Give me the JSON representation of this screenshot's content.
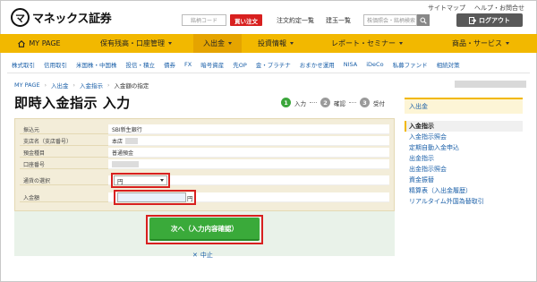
{
  "header": {
    "logo_mark": "マ",
    "logo_text": "マネックス証券",
    "top_links": [
      "サイトマップ",
      "ヘルプ・お問合せ"
    ],
    "code_placeholder": "銘柄コード",
    "buy_order_label": "買い注文",
    "links": [
      "注文約定一覧",
      "建玉一覧"
    ],
    "search_placeholder": "株価照会・銘柄検索",
    "logout_label": "ログアウト"
  },
  "nav": {
    "items": [
      "MY PAGE",
      "保有残高・口座管理",
      "入出金",
      "投資情報",
      "レポート・セミナー",
      "商品・サービス"
    ]
  },
  "subnav": {
    "items": [
      "株式取引",
      "信用取引",
      "米国株・中国株",
      "投信・積立",
      "債券",
      "FX",
      "暗号資産",
      "先OP",
      "金・プラチナ",
      "おまかせ運用",
      "NISA",
      "iDeCo",
      "私募ファンド",
      "相続対策"
    ]
  },
  "breadcrumb": [
    "MY PAGE",
    "入出金",
    "入金指示",
    "入金額の指定"
  ],
  "page_title": "即時入金指示 入力",
  "steps": [
    {
      "num": "1",
      "label": "入力"
    },
    {
      "num": "2",
      "label": "確認"
    },
    {
      "num": "3",
      "label": "受付"
    }
  ],
  "form": {
    "rows": [
      {
        "label": "振込元",
        "value": "SBI新生銀行"
      },
      {
        "label": "支店名（支店番号）",
        "value": "本店"
      },
      {
        "label": "預金種目",
        "value": "普通預金"
      },
      {
        "label": "口座番号",
        "value": ""
      },
      {
        "label": "通貨の選択",
        "value": ""
      },
      {
        "label": "入金額",
        "value": ""
      }
    ],
    "currency_value": "円",
    "amount_unit": "円"
  },
  "buttons": {
    "next_label": "次へ（入力内容確認）",
    "cancel_label": "中止"
  },
  "sidebar": {
    "title": "入出金",
    "items": [
      "入金指示",
      "入金指示照会",
      "定期自動入金申込",
      "出金指示",
      "出金指示照会",
      "資金振替",
      "精算表（入出金履歴）",
      "リアルタイム外国為替取引"
    ]
  },
  "colors": {
    "nav_yellow": "#f2b800",
    "accent_red": "#d8201f",
    "next_green": "#3aaa3a",
    "link_blue": "#1a5fa8"
  }
}
